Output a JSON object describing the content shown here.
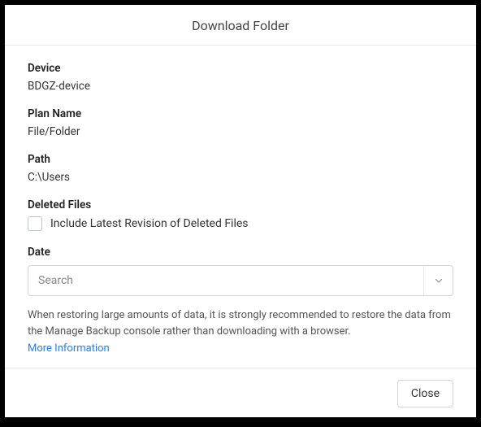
{
  "header": {
    "title": "Download Folder"
  },
  "fields": {
    "device": {
      "label": "Device",
      "value": "BDGZ-device"
    },
    "plan_name": {
      "label": "Plan Name",
      "value": "File/Folder"
    },
    "path": {
      "label": "Path",
      "value": "C:\\Users"
    },
    "deleted_files": {
      "label": "Deleted Files",
      "checkbox_label": "Include Latest Revision of Deleted Files"
    },
    "date": {
      "label": "Date",
      "placeholder": "Search"
    }
  },
  "help": {
    "text": "When restoring large amounts of data, it is strongly recommended to restore the data from the Manage Backup console rather than downloading with a browser.",
    "link_text": "More Information"
  },
  "footer": {
    "close_label": "Close"
  }
}
